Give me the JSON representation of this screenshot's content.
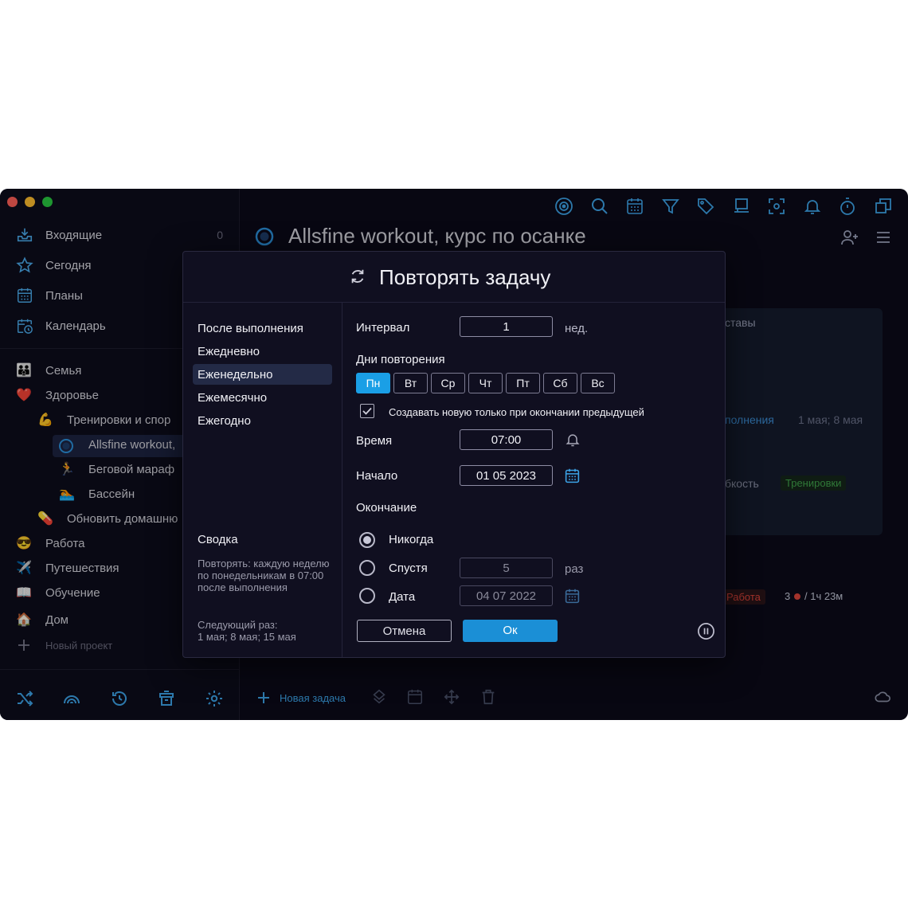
{
  "sidebar": {
    "nav": [
      {
        "label": "Входящие",
        "count": "0"
      },
      {
        "label": "Сегодня",
        "count": ""
      },
      {
        "label": "Планы",
        "count": ""
      },
      {
        "label": "Календарь",
        "count": ""
      }
    ],
    "projects": [
      {
        "label": "Семья",
        "emoji": "👪"
      },
      {
        "label": "Здоровье",
        "emoji": "❤️"
      },
      {
        "label": "Тренировки и спор",
        "emoji": "💪"
      },
      {
        "label": "Allsfine workout,",
        "emoji": ""
      },
      {
        "label": "Беговой мараф",
        "emoji": "🏃"
      },
      {
        "label": "Бассейн",
        "emoji": "🏊"
      },
      {
        "label": "Обновить домашню",
        "emoji": "💊"
      },
      {
        "label": "Работа",
        "emoji": "😎"
      },
      {
        "label": "Путешествия",
        "emoji": "✈️"
      },
      {
        "label": "Обучение",
        "emoji": "📖"
      },
      {
        "label": "Дом",
        "emoji": "🏠"
      }
    ],
    "new_project": "Новый проект"
  },
  "main": {
    "title": "Allsfine workout, курс по осанке",
    "bg_texts": {
      "card_title": "ставы",
      "card_line": "полнения",
      "card_dates": "1 мая; 8 мая",
      "tag_line": "бкость",
      "tag_green": "Тренировки",
      "tag_red": "Работа",
      "count": "3",
      "time": "/ 1ч 23м"
    },
    "new_task": "Новая задача"
  },
  "modal": {
    "title": "Повторять задачу",
    "options": [
      "После выполнения",
      "Ежедневно",
      "Еженедельно",
      "Ежемесячно",
      "Ежегодно"
    ],
    "selected_option": "Еженедельно",
    "interval_label": "Интервал",
    "interval_value": "1",
    "interval_unit": "нед.",
    "days_label": "Дни повторения",
    "days": [
      "Пн",
      "Вт",
      "Ср",
      "Чт",
      "Пт",
      "Сб",
      "Вс"
    ],
    "active_day": "Пн",
    "checkbox_label": "Создавать новую только при окончании предыдущей",
    "checkbox_checked": true,
    "time_label": "Время",
    "time_value": "07:00",
    "start_label": "Начало",
    "start_value": "01 05 2023",
    "end_label": "Окончание",
    "end_options": [
      {
        "label": "Никогда",
        "selected": true
      },
      {
        "label": "Спустя",
        "selected": false,
        "value": "5",
        "unit": "раз"
      },
      {
        "label": "Дата",
        "selected": false,
        "value": "04 07 2022"
      }
    ],
    "summary_title": "Сводка",
    "summary_text": "Повторять: каждую неделю по понедельникам в 07:00 после выполнения",
    "next_label": "Следующий раз:",
    "next_value": "1 мая; 8 мая; 15 мая",
    "cancel": "Отмена",
    "ok": "Ок"
  },
  "colors": {
    "accent": "#1a9fe6",
    "ok": "#1b8fd6",
    "bg": "#0b0a18",
    "green": "#3fa04a",
    "red": "#d9433a"
  }
}
